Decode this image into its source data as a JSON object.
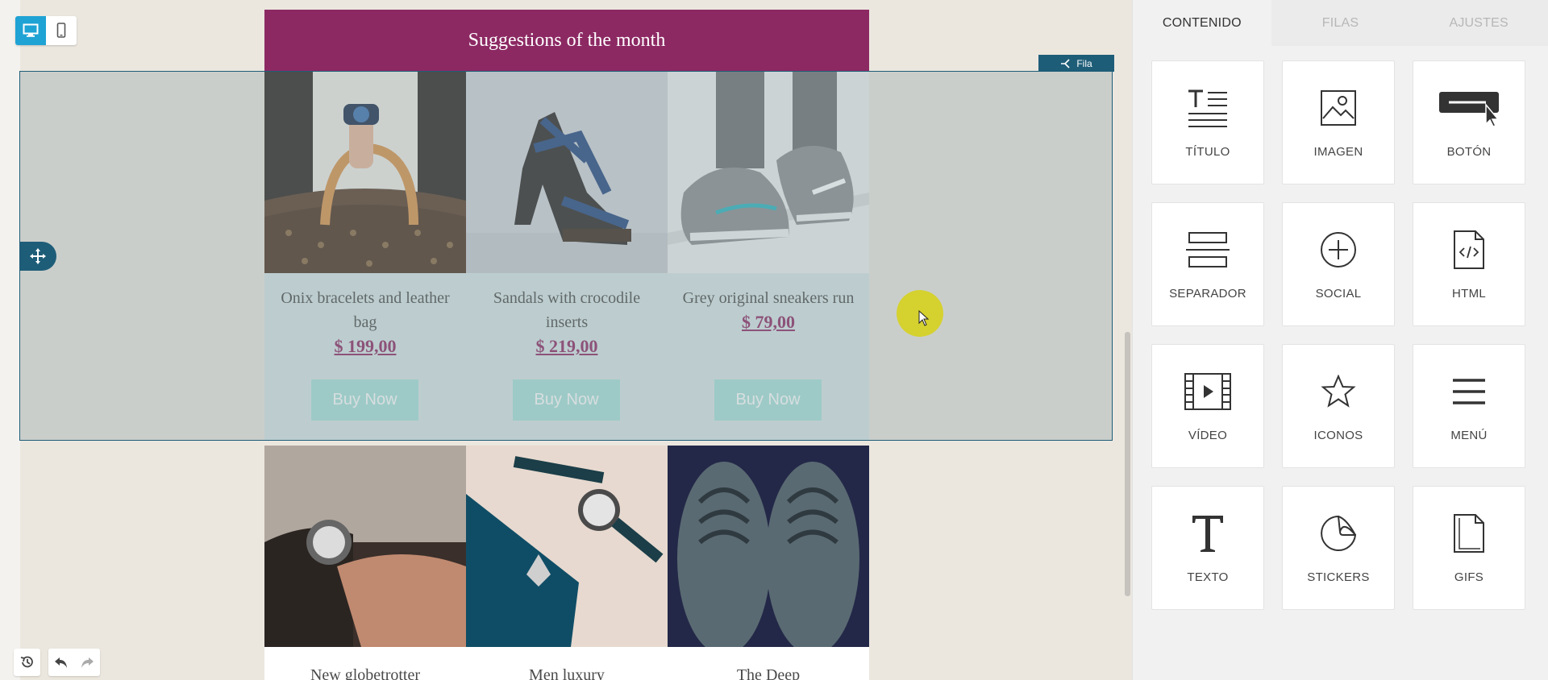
{
  "toolbar": {
    "desktop_view_icon": "desktop-icon",
    "mobile_view_icon": "mobile-icon"
  },
  "email": {
    "header_title": "Suggestions of the month",
    "row_tag_label": "Fila",
    "row1": [
      {
        "name": "Onix bracelets and leather bag",
        "price": "$ 199,00",
        "button": "Buy Now"
      },
      {
        "name": "Sandals with crocodile inserts",
        "price": "$ 219,00",
        "button": "Buy Now"
      },
      {
        "name": "Grey original sneakers run",
        "price": "$ 79,00",
        "button": "Buy Now"
      }
    ],
    "row2": [
      {
        "name": "New globetrotter"
      },
      {
        "name": "Men luxury"
      },
      {
        "name": "The Deep"
      }
    ]
  },
  "sidebar": {
    "tabs": [
      {
        "label": "CONTENIDO",
        "active": true
      },
      {
        "label": "FILAS",
        "active": false
      },
      {
        "label": "AJUSTES",
        "active": false
      }
    ],
    "blocks": [
      {
        "label": "TÍTULO",
        "icon": "title-icon"
      },
      {
        "label": "IMAGEN",
        "icon": "image-icon"
      },
      {
        "label": "BOTÓN",
        "icon": "button-icon"
      },
      {
        "label": "SEPARADOR",
        "icon": "divider-icon"
      },
      {
        "label": "SOCIAL",
        "icon": "social-plus-icon"
      },
      {
        "label": "HTML",
        "icon": "html-file-icon"
      },
      {
        "label": "VÍDEO",
        "icon": "video-icon"
      },
      {
        "label": "ICONOS",
        "icon": "star-icon"
      },
      {
        "label": "MENÚ",
        "icon": "menu-icon"
      },
      {
        "label": "TEXTO",
        "icon": "text-icon"
      },
      {
        "label": "STICKERS",
        "icon": "sticker-icon"
      },
      {
        "label": "GIFS",
        "icon": "gif-file-icon"
      }
    ]
  },
  "colors": {
    "brand": "#8c2963",
    "accent": "#1fa3d4",
    "selection": "#1e5d78",
    "button": "#a7e0da"
  }
}
